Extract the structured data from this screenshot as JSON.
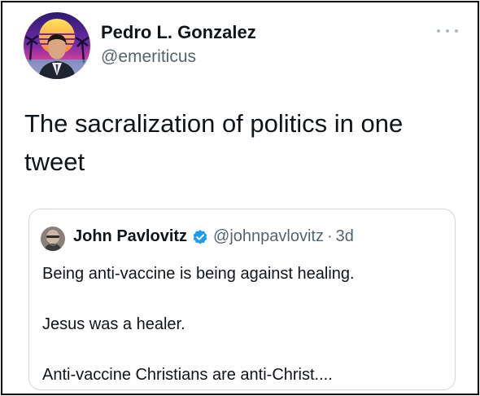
{
  "author": {
    "name": "Pedro L. Gonzalez",
    "handle": "@emeriticus"
  },
  "tweet": {
    "text": "The sacralization of politics in one tweet"
  },
  "quoted_tweet": {
    "author_name": "John Pavlovitz",
    "handle": "@johnpavlovitz",
    "separator": "·",
    "time": "3d",
    "verified": true,
    "lines": [
      "Being anti-vaccine is being against healing.",
      "Jesus was a healer.",
      "Anti-vaccine Christians are anti-Christ...."
    ]
  },
  "icons": {
    "more": "more-horizontal-icon",
    "verified": "verified-badge-icon"
  },
  "colors": {
    "text_primary": "#0f1419",
    "text_secondary": "#536471",
    "verified_blue": "#1d9bf0",
    "quote_border": "#cfd9de"
  }
}
